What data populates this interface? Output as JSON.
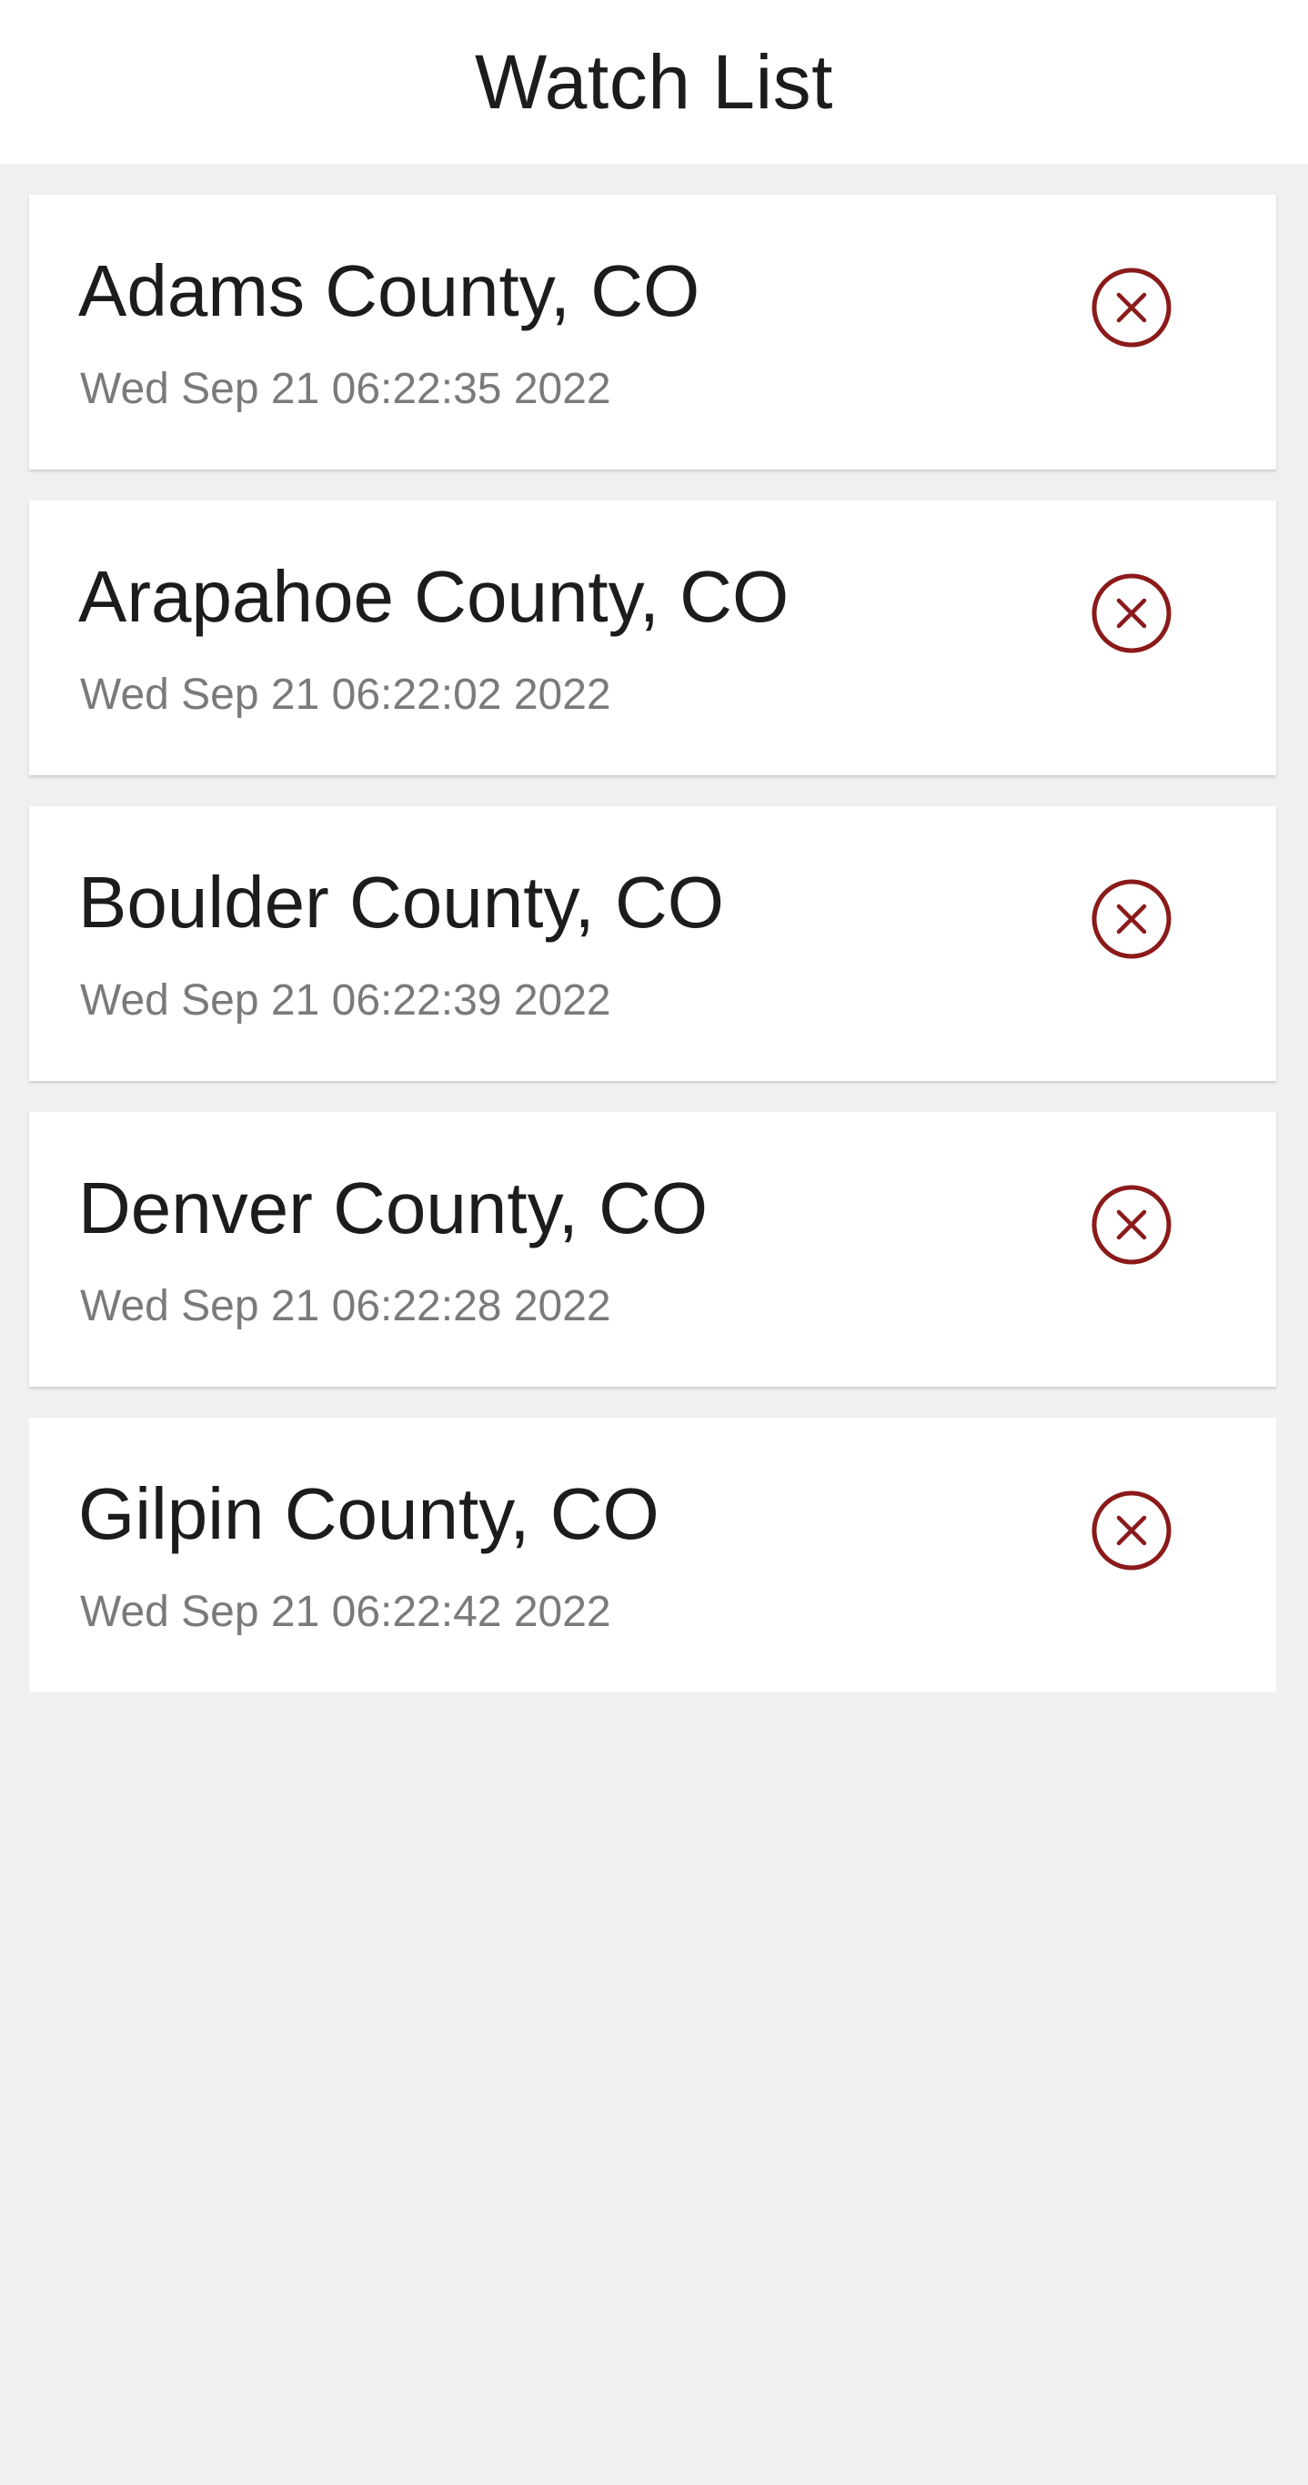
{
  "header": {
    "title": "Watch List"
  },
  "colors": {
    "remove_icon": "#8b1a1a",
    "header_bg": "#ffffff",
    "page_bg": "#f0f0f0",
    "primary_text": "#1c1c1c",
    "secondary_text": "#7a7a7a"
  },
  "watch_list": {
    "items": [
      {
        "name": "Adams County, CO",
        "timestamp": "Wed Sep 21 06:22:35 2022",
        "action_icon": "remove-circle-x-icon"
      },
      {
        "name": "Arapahoe County, CO",
        "timestamp": "Wed Sep 21 06:22:02 2022",
        "action_icon": "remove-circle-x-icon"
      },
      {
        "name": "Boulder County, CO",
        "timestamp": "Wed Sep 21 06:22:39 2022",
        "action_icon": "remove-circle-x-icon"
      },
      {
        "name": "Denver County, CO",
        "timestamp": "Wed Sep 21 06:22:28 2022",
        "action_icon": "remove-circle-x-icon"
      },
      {
        "name": "Gilpin County, CO",
        "timestamp": "Wed Sep 21 06:22:42 2022",
        "action_icon": "remove-circle-x-icon"
      }
    ]
  }
}
